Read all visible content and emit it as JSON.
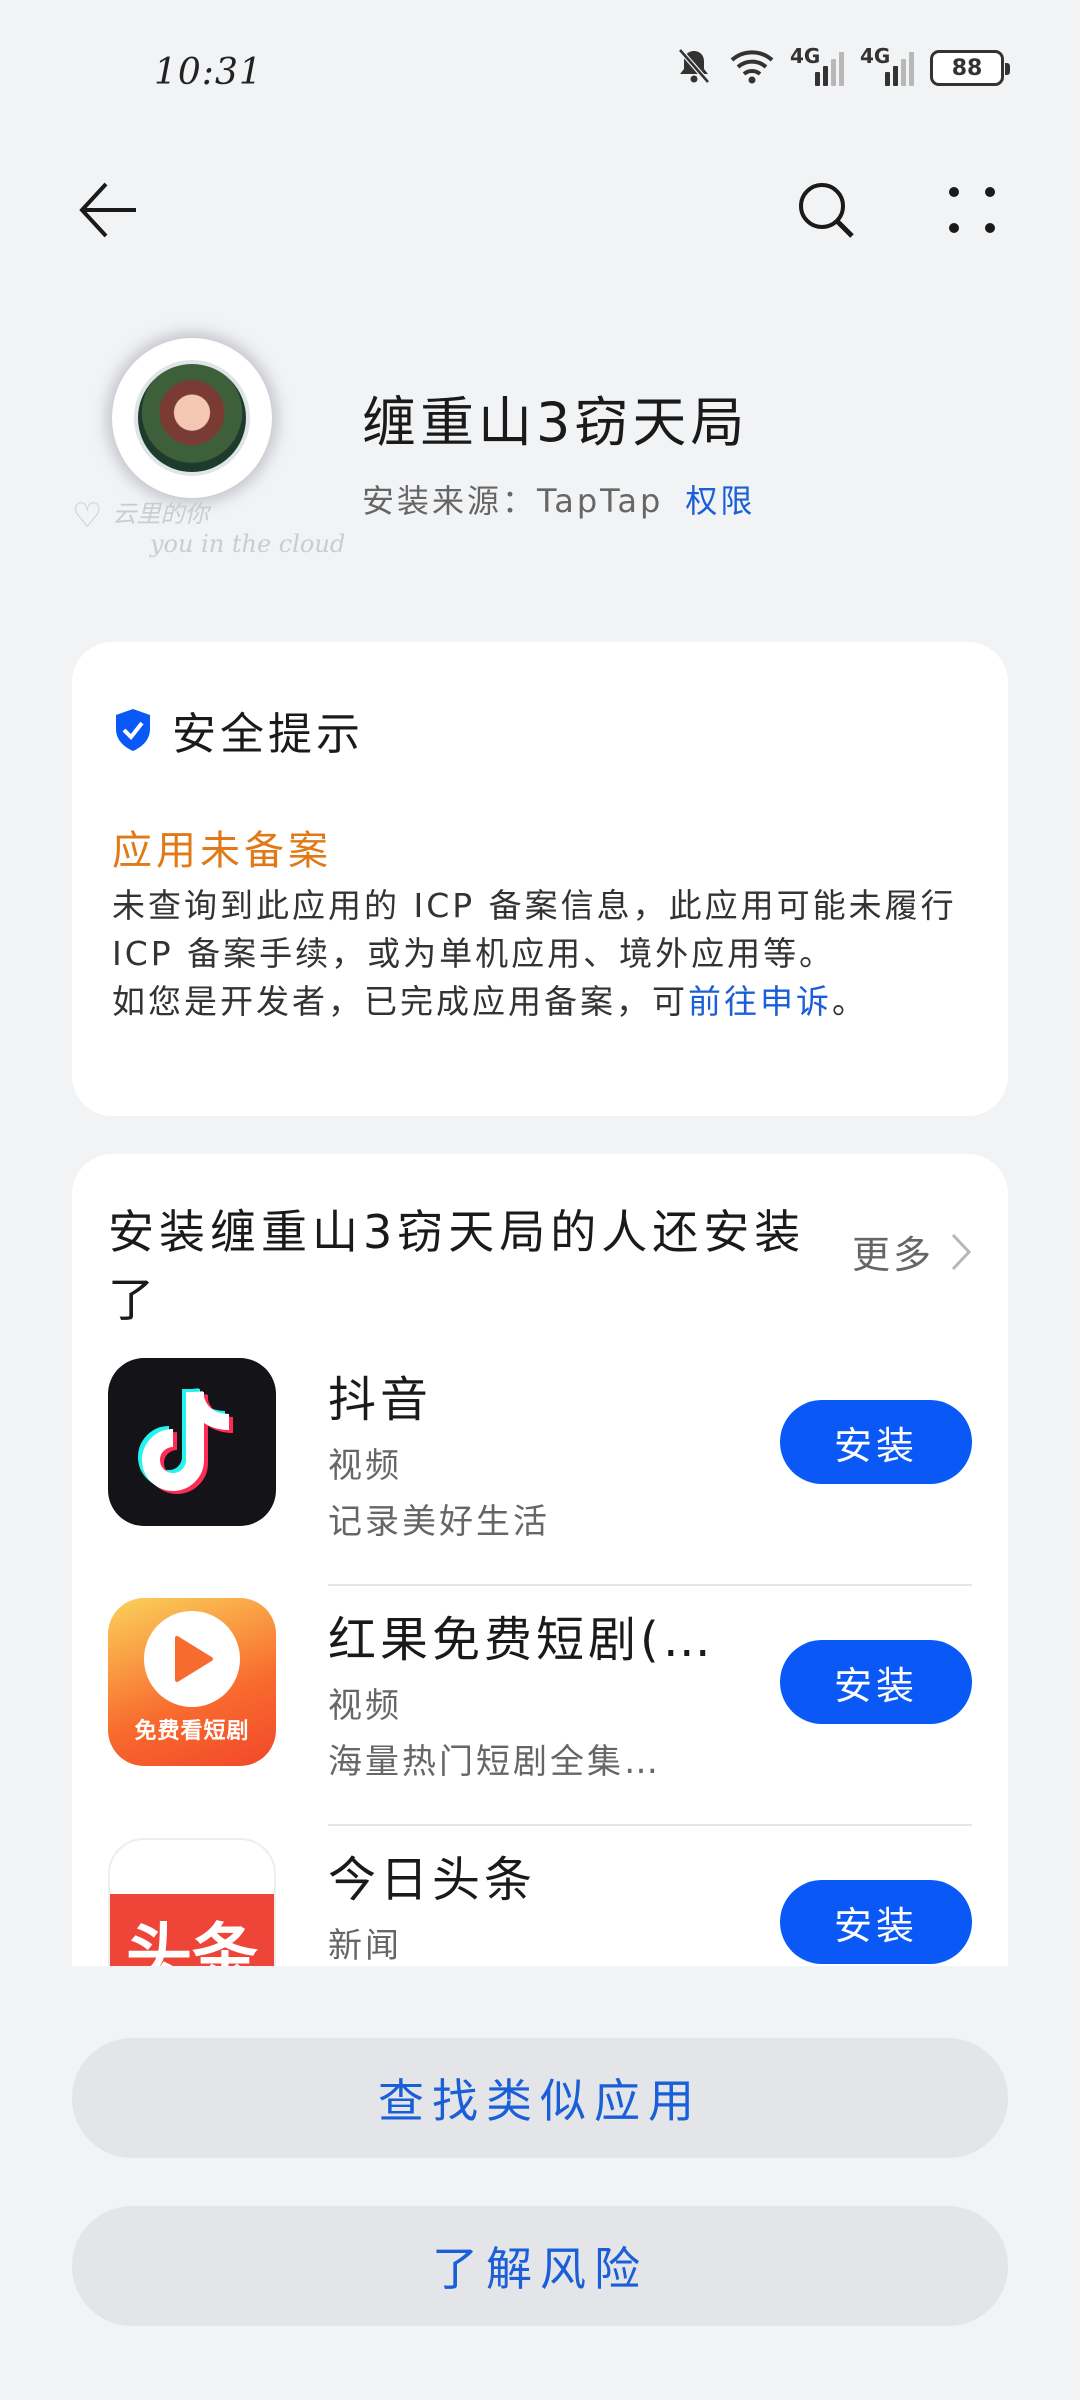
{
  "status_bar": {
    "time": "10:31",
    "network_1": "4G",
    "network_2": "4G",
    "battery": "88"
  },
  "app": {
    "name": "缠重山3窃天局",
    "source_label": "安装来源：TapTap",
    "permissions_link": "权限",
    "avatar_watermark_line1": "云里的你",
    "avatar_watermark_line2": "you in the cloud"
  },
  "safety": {
    "title": "安全提示",
    "warning_title": "应用未备案",
    "warning_text": "未查询到此应用的 ICP 备案信息，此应用可能未履行 ICP 备案手续，或为单机应用、境外应用等。",
    "developer_text": "如您是开发者，已完成应用备案，可",
    "appeal_link": "前往申诉",
    "period": "。"
  },
  "recommendations": {
    "title": "安装缠重山3窃天局的人还安装了",
    "more_label": "更多",
    "items": [
      {
        "name": "抖音",
        "category": "视频",
        "description": "记录美好生活",
        "button": "安装"
      },
      {
        "name": "红果免费短剧(…",
        "category": "视频",
        "description": "海量热门短剧全集…",
        "button": "安装",
        "icon_text": "免费看短剧"
      },
      {
        "name": "今日头条",
        "category": "新闻",
        "description": "",
        "button": "安装",
        "icon_text": "头条"
      }
    ]
  },
  "actions": {
    "find_similar": "查找类似应用",
    "learn_risk": "了解风险"
  },
  "colors": {
    "accent": "#0a59f7",
    "link": "#1a5fd8",
    "warning": "#e07a18",
    "background": "#f1f3f5"
  }
}
